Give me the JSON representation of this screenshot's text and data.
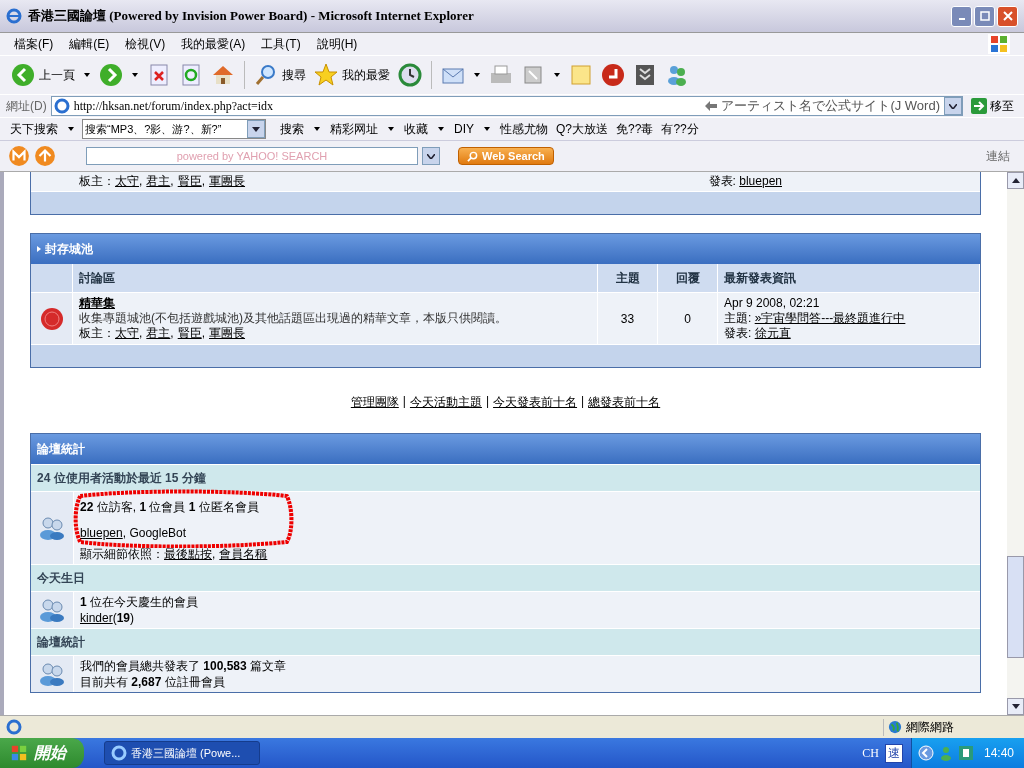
{
  "window": {
    "title": "香港三國論壇 (Powered by Invision Power Board) - Microsoft Internet Explorer"
  },
  "menu": [
    "檔案(F)",
    "編輯(E)",
    "檢視(V)",
    "我的最愛(A)",
    "工具(T)",
    "說明(H)"
  ],
  "toolbar": [
    {
      "kind": "back",
      "label": "上一頁",
      "dropdown": true
    },
    {
      "kind": "forward",
      "dropdown": true
    },
    {
      "kind": "stop"
    },
    {
      "kind": "refresh"
    },
    {
      "kind": "home"
    },
    {
      "kind": "search",
      "label": "搜尋"
    },
    {
      "kind": "favorites",
      "label": "我的最愛"
    },
    {
      "kind": "history"
    },
    {
      "kind": "mail",
      "dropdown": true
    },
    {
      "kind": "print"
    },
    {
      "kind": "window",
      "dropdown": true
    },
    {
      "kind": "note"
    },
    {
      "kind": "red"
    },
    {
      "kind": "book"
    },
    {
      "kind": "messenger"
    }
  ],
  "address": {
    "label": "網址(D)",
    "value": "http://hksan.net/forum/index.php?act=idx",
    "hint": "アーティスト名で公式サイト(J Word)",
    "go": "移至"
  },
  "search_bar": {
    "brand": "天下搜索",
    "field": "搜索“MP3、?影、游?、新?”",
    "items": [
      {
        "label": "搜索",
        "dropdown": true
      },
      {
        "label": "精彩网址",
        "dropdown": true
      },
      {
        "label": "收藏",
        "dropdown": true
      },
      {
        "label": "DIY",
        "dropdown": true
      },
      {
        "label": "性感尤物",
        "dropdown": false
      },
      {
        "label": "Q?大放送",
        "dropdown": false
      },
      {
        "label": "免??毒",
        "dropdown": false
      },
      {
        "label": "有??分",
        "dropdown": false
      }
    ]
  },
  "yahoo_bar": {
    "placeholder": "powered by YAHOO! SEARCH",
    "button": "Web Search",
    "links": "連結"
  },
  "separator": ",",
  "top_fragment": {
    "moderators_label": "板主：",
    "moderators": [
      "太守",
      "君主",
      "賢臣",
      "軍團長"
    ],
    "by_label": "發表:",
    "by": "bluepen"
  },
  "category": {
    "title": "封存城池",
    "columns": [
      "討論區",
      "主題",
      "回覆",
      "最新發表資訊"
    ],
    "rows": [
      {
        "name": "精華集",
        "description": "收集專題城池(不包括遊戲城池)及其他話題區出現過的精華文章，本版只供閱讀。",
        "moderators_label": "板主：",
        "moderators": [
          "太守",
          "君主",
          "賢臣",
          "軍團長"
        ],
        "topics": "33",
        "replies": "0",
        "last_date": "Apr 9 2008, 02:21",
        "topic_label": "主題:",
        "topic": "»宇宙學問答---最終題進行中",
        "by_label": "發表:",
        "by": "徐元直"
      }
    ]
  },
  "links_separator": "|",
  "links": [
    "管理團隊",
    "今天活動主題",
    "今天發表前十名",
    "總發表前十名"
  ],
  "stats": {
    "title": "論壇統計",
    "sections": [
      {
        "heading": "24 位使用者活動於最近 15 分鐘",
        "circled": true,
        "lines": [
          [
            {
              "kind": "text",
              "text": "**22** 位訪客, **1** 位會員 **1** 位匿名會員"
            }
          ],
          [
            {
              "kind": "link",
              "text": "bluepen"
            },
            {
              "kind": "text",
              "text": ", GoogleBot"
            }
          ]
        ],
        "sort": {
          "label": "顯示細節依照：",
          "links": [
            "最後點按",
            "會員名稱"
          ]
        }
      },
      {
        "heading": "今天生日",
        "circled": false,
        "lines": [
          [
            {
              "kind": "text",
              "text": "**1** 位在今天慶生的會員"
            }
          ],
          [
            {
              "kind": "link",
              "text": "kinder"
            },
            {
              "kind": "text",
              "text": "(**19**)"
            }
          ]
        ]
      },
      {
        "heading": "論壇統計",
        "circled": false,
        "lines": [
          [
            {
              "kind": "text",
              "text": "我們的會員總共發表了 **100,583** 篇文章"
            }
          ],
          [
            {
              "kind": "text",
              "text": "目前共有 **2,687** 位註冊會員"
            }
          ]
        ]
      }
    ]
  },
  "status_bar": {
    "zone": "網際網路"
  },
  "taskbar": {
    "start": "開始",
    "task": "香港三國論壇 (Powe...",
    "lang": "CH",
    "ime": "速",
    "clock": "14:40"
  }
}
